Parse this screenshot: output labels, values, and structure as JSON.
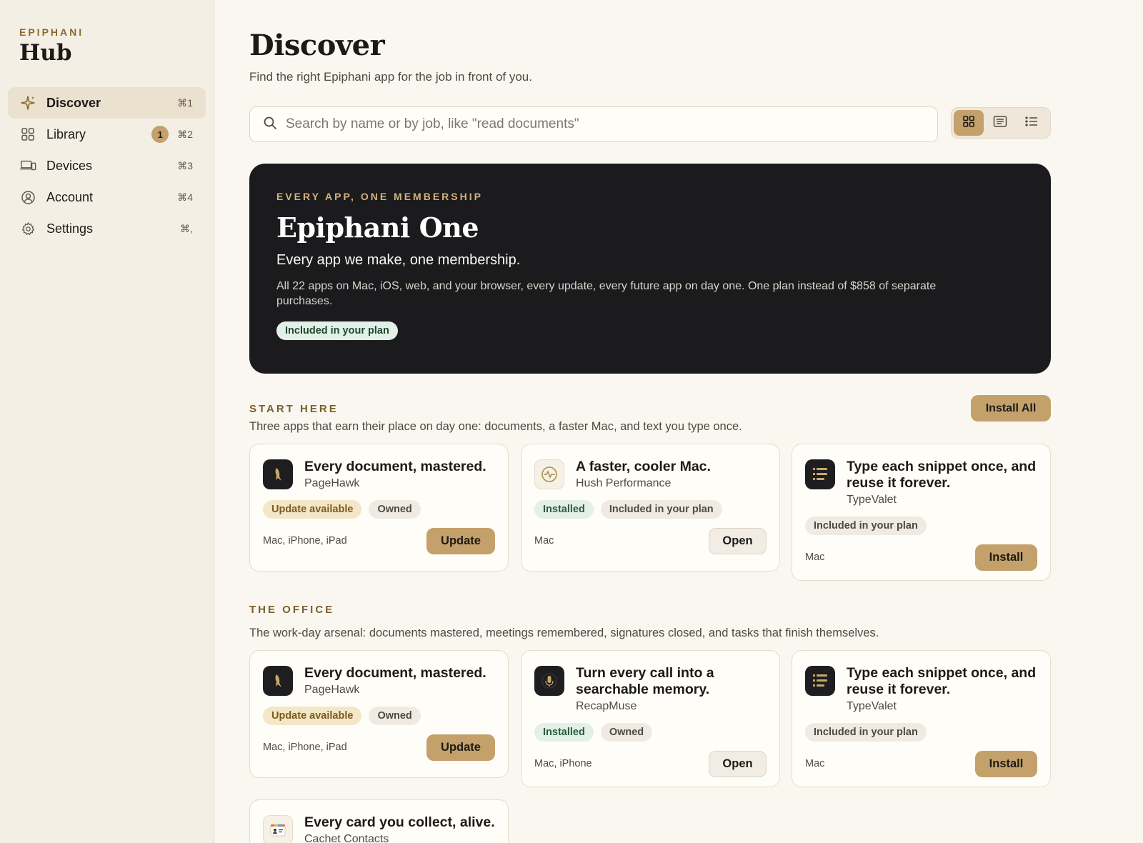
{
  "sidebar": {
    "brand_top": "EPIPHANI",
    "brand_main": "Hub",
    "items": [
      {
        "label": "Discover",
        "shortcut": "⌘1",
        "icon": "sparkle-icon",
        "active": true
      },
      {
        "label": "Library",
        "shortcut": "⌘2",
        "icon": "grid-icon",
        "badge": "1"
      },
      {
        "label": "Devices",
        "shortcut": "⌘3",
        "icon": "devices-icon"
      },
      {
        "label": "Account",
        "shortcut": "⌘4",
        "icon": "user-circle-icon"
      },
      {
        "label": "Settings",
        "shortcut": "⌘,",
        "icon": "gear-icon"
      }
    ]
  },
  "main": {
    "title": "Discover",
    "subtitle": "Find the right Epiphani app for the job in front of you.",
    "search": {
      "placeholder": "Search by name or by job, like \"read documents\"",
      "value": ""
    },
    "view_modes": [
      "grid",
      "cards",
      "list"
    ],
    "active_view": "grid"
  },
  "hero": {
    "eyebrow": "EVERY APP, ONE MEMBERSHIP",
    "title": "Epiphani One",
    "tagline": "Every app we make, one membership.",
    "description": "All 22 apps on Mac, iOS, web, and your browser, every update, every future app on day one. One plan instead of $858 of separate purchases.",
    "pill": "Included in your plan"
  },
  "start_here": {
    "eyebrow": "START HERE",
    "description": "Three apps that earn their place on day one: documents, a faster Mac, and text you type once.",
    "install_all": "Install All",
    "cards": [
      {
        "title": "Every document, mastered.",
        "app": "PageHawk",
        "pills": [
          "Update available",
          "Owned"
        ],
        "platforms": "Mac, iPhone, iPad",
        "action": "Update"
      },
      {
        "title": "A faster, cooler Mac.",
        "app": "Hush Performance",
        "pills": [
          "Installed",
          "Included in your plan"
        ],
        "platforms": "Mac",
        "action": "Open"
      },
      {
        "title": "Type each snippet once, and reuse it forever.",
        "app": "TypeValet",
        "pills": [
          "Included in your plan"
        ],
        "platforms": "Mac",
        "action": "Install"
      }
    ]
  },
  "office": {
    "eyebrow": "THE OFFICE",
    "description": "The work-day arsenal: documents mastered, meetings remembered, signatures closed, and tasks that finish themselves.",
    "cards": [
      {
        "title": "Every document, mastered.",
        "app": "PageHawk",
        "pills": [
          "Update available",
          "Owned"
        ],
        "platforms": "Mac, iPhone, iPad",
        "action": "Update"
      },
      {
        "title": "Turn every call into a searchable memory.",
        "app": "RecapMuse",
        "pills": [
          "Installed",
          "Owned"
        ],
        "platforms": "Mac, iPhone",
        "action": "Open"
      },
      {
        "title": "Type each snippet once, and reuse it forever.",
        "app": "TypeValet",
        "pills": [
          "Included in your plan"
        ],
        "platforms": "Mac",
        "action": "Install"
      },
      {
        "title": "Every card you collect, alive.",
        "app": "Cachet Contacts"
      }
    ]
  },
  "colors": {
    "accent_gold": "#c4a16b",
    "hero_bg": "#1b1b1e",
    "page_bg": "#faf7f0",
    "sidebar_bg": "#f4efe4"
  }
}
